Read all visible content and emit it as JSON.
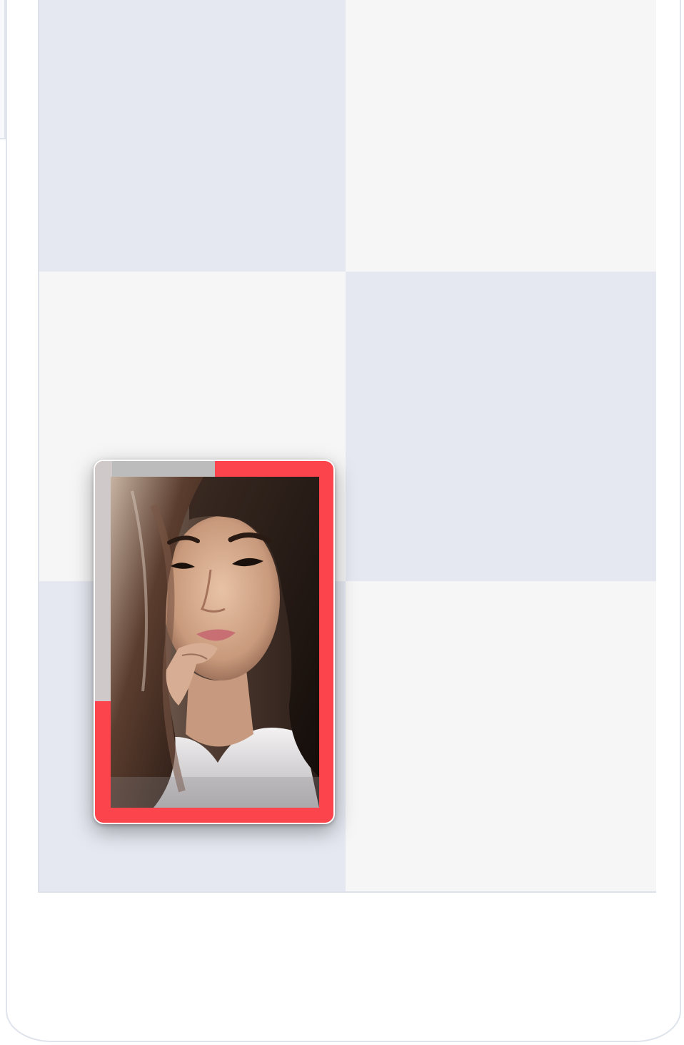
{
  "screen": {
    "grid": {
      "rows": [
        [
          "blue",
          "grey"
        ],
        [
          "grey",
          "blue"
        ],
        [
          "blue",
          "grey"
        ]
      ]
    },
    "photo_card": {
      "photo": "portrait-photo",
      "accent_color": "#fb444c"
    }
  }
}
